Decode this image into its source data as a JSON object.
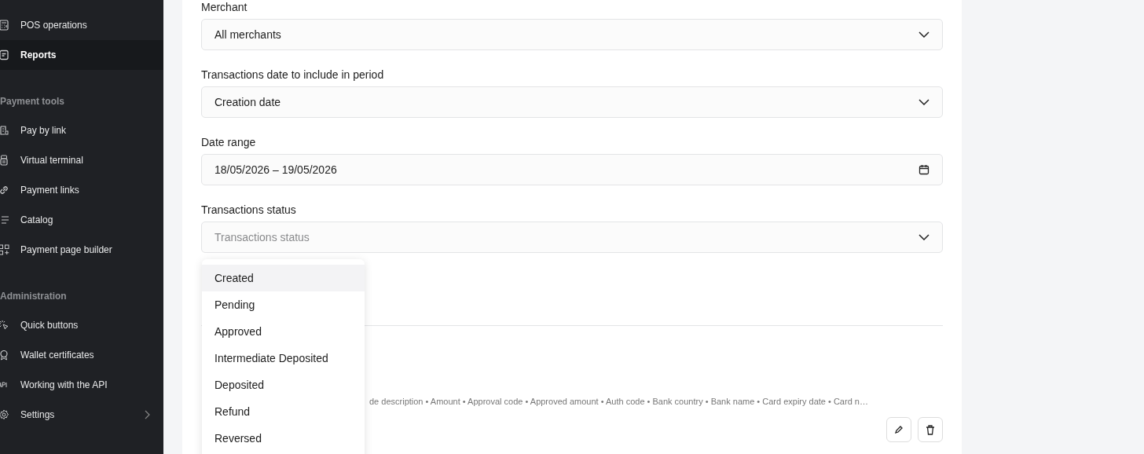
{
  "sidebar": {
    "groups": [
      {
        "items": [
          {
            "label": "POS operations",
            "selected": false
          },
          {
            "label": "Reports",
            "selected": true
          }
        ]
      },
      {
        "title": "Payment tools",
        "items": [
          {
            "label": "Pay by link",
            "selected": false
          },
          {
            "label": "Virtual terminal",
            "selected": false
          },
          {
            "label": "Payment links",
            "selected": false
          },
          {
            "label": "Catalog",
            "selected": false
          },
          {
            "label": "Payment page builder",
            "selected": false
          }
        ]
      },
      {
        "title": "Administration",
        "items": [
          {
            "label": "Quick buttons",
            "selected": false
          },
          {
            "label": "Wallet certificates",
            "selected": false
          },
          {
            "label": "Working with the API",
            "selected": false
          },
          {
            "label": "Settings",
            "selected": false
          }
        ]
      }
    ]
  },
  "form": {
    "fields": [
      {
        "label": "Merchant",
        "kind": "select",
        "value": "All merchants"
      },
      {
        "label": "Transactions date to include in period",
        "kind": "select",
        "value": "Creation date"
      },
      {
        "label": "Date range",
        "kind": "date",
        "value": "18/05/2026 – 19/05/2026"
      },
      {
        "label": "Transactions status",
        "kind": "select",
        "placeholder": "Transactions status"
      }
    ],
    "status_options": [
      {
        "label": "Created",
        "selected": true
      },
      {
        "label": "Pending",
        "selected": false
      },
      {
        "label": "Approved",
        "selected": false
      },
      {
        "label": "Intermediate Deposited",
        "selected": false
      },
      {
        "label": "Deposited",
        "selected": false
      },
      {
        "label": "Refund",
        "selected": false
      },
      {
        "label": "Reversed",
        "selected": false
      }
    ],
    "columns_summary": "de description • Amount • Approval code • Approved amount • Auth code • Bank country • Bank name • Card expiry date • Card n…"
  }
}
